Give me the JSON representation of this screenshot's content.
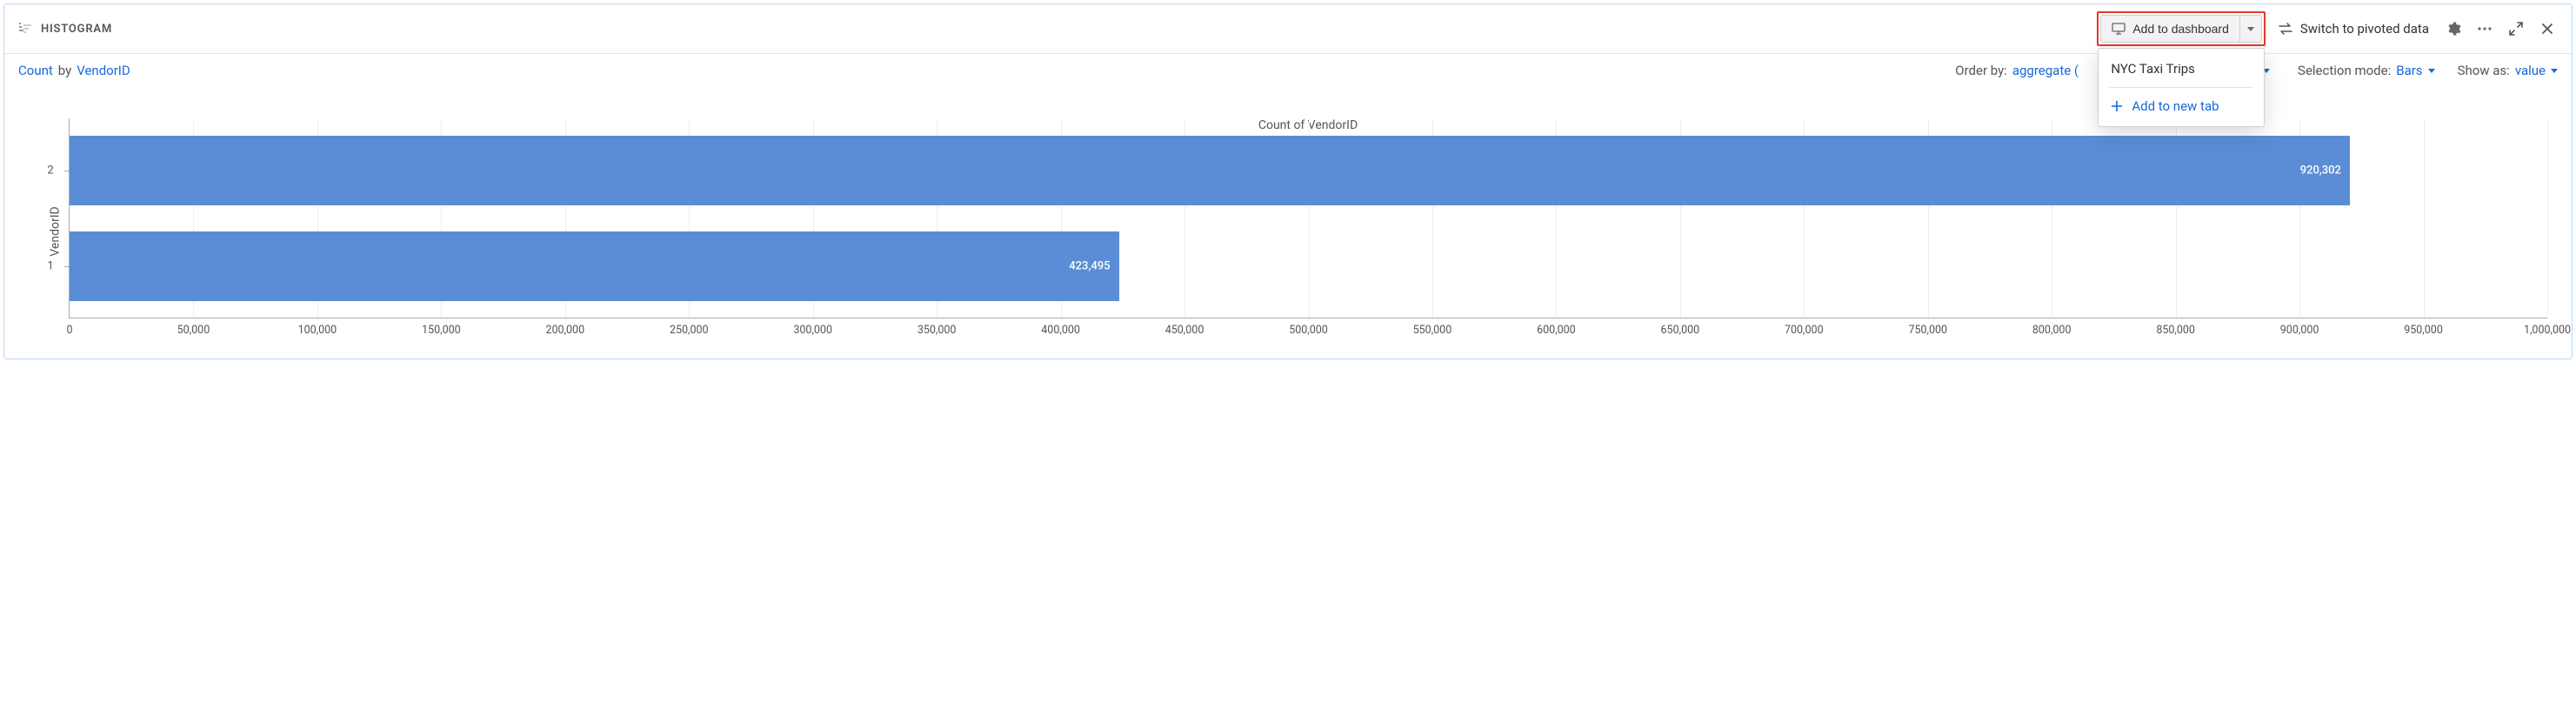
{
  "header": {
    "title": "HISTOGRAM",
    "add_to_dashboard": "Add to dashboard",
    "switch_pivot": "Switch to pivoted data"
  },
  "dropdown": {
    "items": [
      {
        "label": "NYC Taxi Trips",
        "primary": false
      }
    ],
    "add_new_tab": "Add to new tab"
  },
  "subheader": {
    "count_label": "Count",
    "by_label": "by",
    "field": "VendorID",
    "order_by_label": "Order by:",
    "order_by_value": "aggregate (",
    "selection_mode_label": "Selection mode:",
    "selection_mode_value": "Bars",
    "show_as_label": "Show as:",
    "show_as_value": "value"
  },
  "chart_data": {
    "type": "bar",
    "orientation": "horizontal",
    "categories": [
      "2",
      "1"
    ],
    "values": [
      920302,
      423495
    ],
    "value_labels": [
      "920,302",
      "423,495"
    ],
    "xlabel": "Count of VendorID",
    "ylabel": "VendorID",
    "xlim": [
      0,
      1000000
    ],
    "xtick_step": 50000,
    "xticks": [
      0,
      50000,
      100000,
      150000,
      200000,
      250000,
      300000,
      350000,
      400000,
      450000,
      500000,
      550000,
      600000,
      650000,
      700000,
      750000,
      800000,
      850000,
      900000,
      950000,
      1000000
    ],
    "xtick_labels": [
      "0",
      "50,000",
      "100,000",
      "150,000",
      "200,000",
      "250,000",
      "300,000",
      "350,000",
      "400,000",
      "450,000",
      "500,000",
      "550,000",
      "600,000",
      "650,000",
      "700,000",
      "750,000",
      "800,000",
      "850,000",
      "900,000",
      "950,000",
      "1,000,000"
    ]
  }
}
